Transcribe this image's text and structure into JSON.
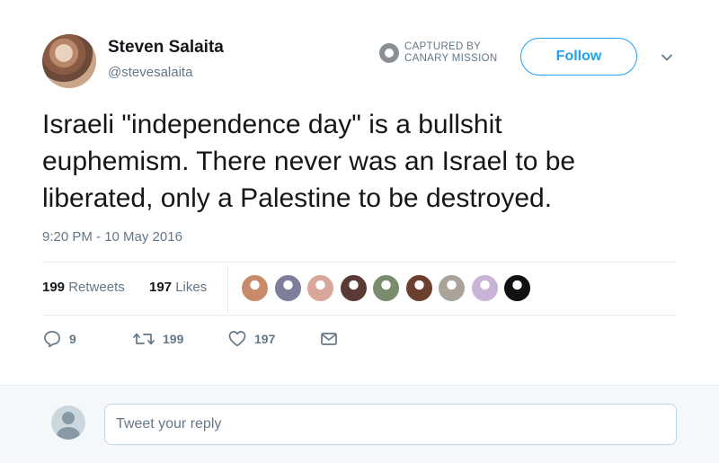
{
  "tweet": {
    "author": {
      "display_name": "Steven Salaita",
      "handle": "@stevesalaita"
    },
    "watermark": {
      "line1": "CAPTURED BY",
      "line2": "CANARY MISSION"
    },
    "follow_label": "Follow",
    "text_lines": [
      "Israeli \"independence day\" is a bullshit",
      "euphemism.  There never was an Israel to be",
      "liberated, only a Palestine to be destroyed."
    ],
    "timestamp": "9:20 PM - 10 May 2016",
    "stats": {
      "retweets_count": "199",
      "retweets_label": "Retweets",
      "likes_count": "197",
      "likes_label": "Likes"
    },
    "liker_avatars": [
      {
        "color": "#c98a6a"
      },
      {
        "color": "#7d7f9a"
      },
      {
        "color": "#d9a79a"
      },
      {
        "color": "#5a3a34"
      },
      {
        "color": "#7a8c6e"
      },
      {
        "color": "#6b3f2e"
      },
      {
        "color": "#a9a39a"
      },
      {
        "color": "#c9b4d8"
      },
      {
        "color": "#111111"
      }
    ],
    "actions": {
      "reply_count": "9",
      "retweet_count": "199",
      "like_count": "197"
    }
  },
  "reply": {
    "placeholder": "Tweet your reply"
  },
  "colors": {
    "accent": "#1da1f2",
    "text": "#14171a",
    "muted": "#657786"
  }
}
